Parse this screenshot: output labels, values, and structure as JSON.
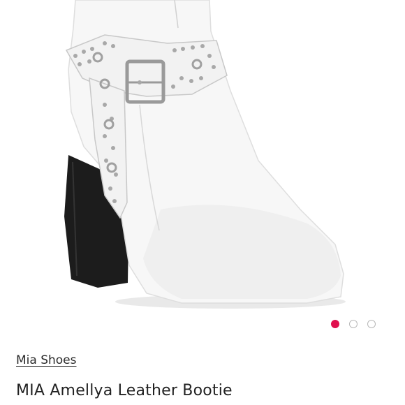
{
  "product": {
    "brand": "Mia Shoes",
    "title": "MIA Amellya Leather Bootie"
  },
  "carousel": {
    "image_count": 3,
    "active_index": 0,
    "active_color": "#e0104f"
  }
}
